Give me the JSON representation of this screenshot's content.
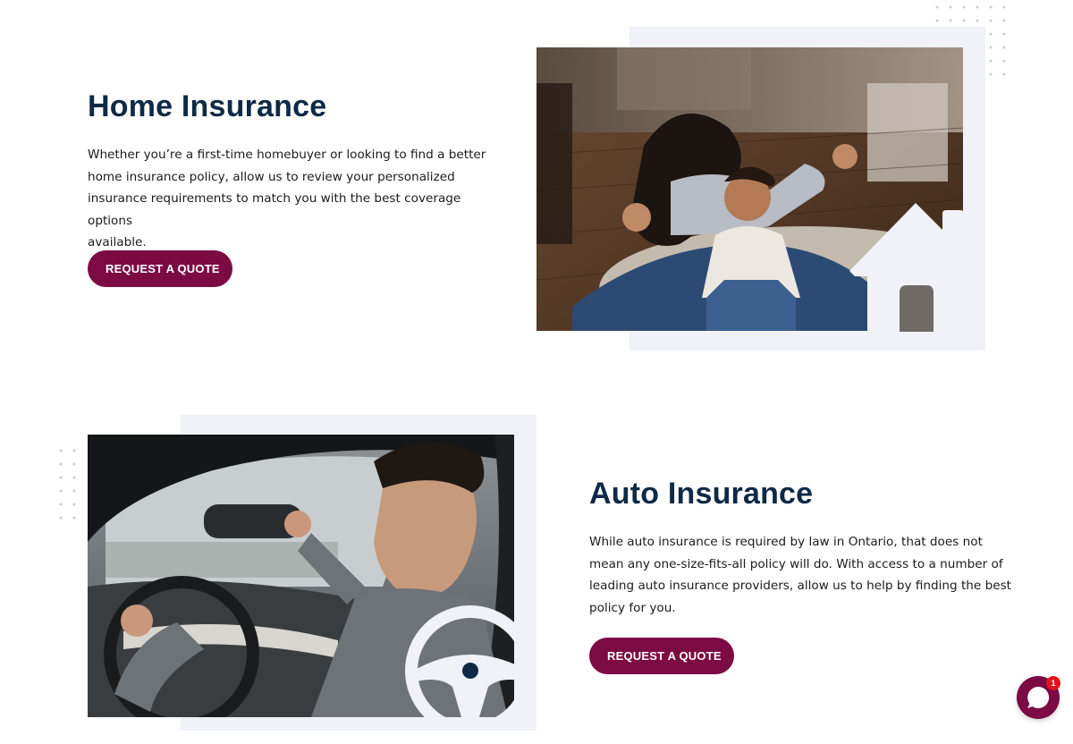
{
  "home": {
    "title": "Home Insurance",
    "description_lines": [
      "Whether you’re a first-time homebuyer or looking to find a better",
      "home insurance policy, allow us to review your personalized",
      "insurance requirements to match you with the best coverage options",
      "available."
    ],
    "cta_label": "REQUEST A QUOTE",
    "image_alt": "Mother and daughter playing on the floor of their home"
  },
  "auto": {
    "title": "Auto Insurance",
    "description_lines": [
      "While auto insurance is required by law in Ontario, that does not",
      "mean any one-size-fits-all policy will do. With access to a number of",
      "leading auto insurance providers, allow us to help by finding the best",
      "policy for you."
    ],
    "cta_label": "REQUEST A QUOTE",
    "image_alt": "Man adjusting rear-view mirror in his car"
  },
  "chat": {
    "icon": "chat-bubble-icon",
    "badge_count": "1"
  },
  "colors": {
    "heading": "#0e2a47",
    "accent": "#7c0a43",
    "backdrop": "#f0f2f8",
    "badge": "#e0141e"
  }
}
